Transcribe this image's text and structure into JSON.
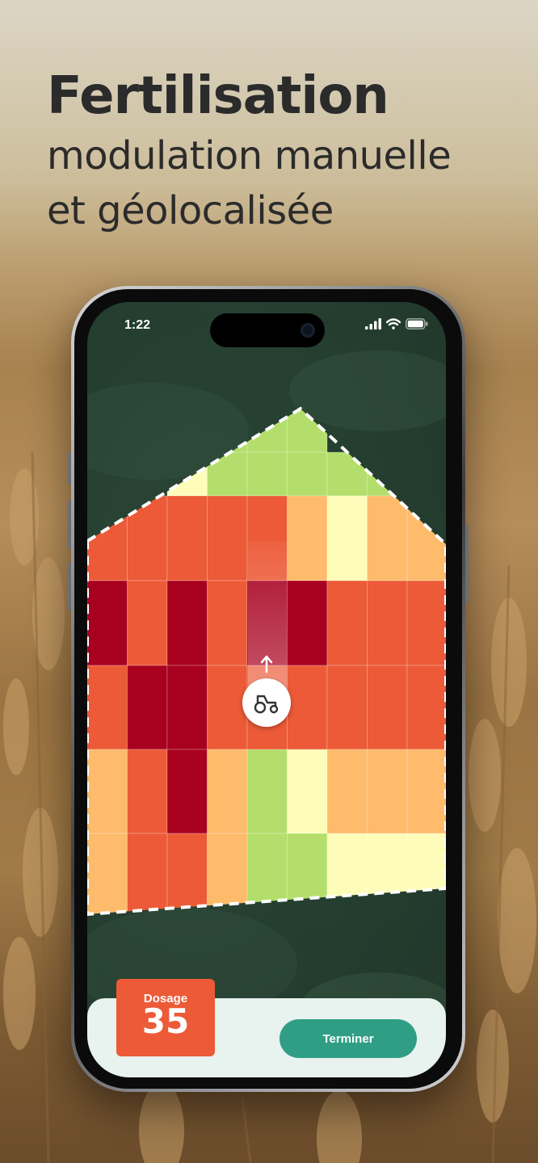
{
  "headline": {
    "title": "Fertilisation",
    "subtitle_line1": "modulation manuelle",
    "subtitle_line2": "et géolocalisée"
  },
  "status_bar": {
    "time": "1:22",
    "icons": [
      "cellular-signal-icon",
      "wifi-icon",
      "battery-icon"
    ]
  },
  "map": {
    "zone_colors": {
      "light_green": "#b3de6b",
      "pale_yellow": "#fdfdb9",
      "light_orange": "#fdbb6b",
      "orange": "#ec5a37",
      "dark_red": "#a8001f"
    },
    "grid": [
      [
        "_",
        "_",
        "_",
        "light_green",
        "light_green",
        "light_green",
        "_",
        "_",
        "_"
      ],
      [
        "_",
        "_",
        "pale_yellow",
        "light_green",
        "light_green",
        "light_green",
        "light_green",
        "light_green",
        "_"
      ],
      [
        "orange",
        "orange",
        "orange",
        "orange",
        "orange",
        "light_orange",
        "pale_yellow",
        "light_orange",
        "light_orange"
      ],
      [
        "dark_red",
        "orange",
        "dark_red",
        "orange",
        "dark_red",
        "dark_red",
        "orange",
        "orange",
        "orange"
      ],
      [
        "orange",
        "dark_red",
        "dark_red",
        "orange",
        "orange",
        "orange",
        "orange",
        "orange",
        "orange"
      ],
      [
        "light_orange",
        "orange",
        "dark_red",
        "light_orange",
        "light_green",
        "pale_yellow",
        "light_orange",
        "light_orange",
        "light_orange"
      ],
      [
        "light_orange",
        "orange",
        "orange",
        "light_orange",
        "light_green",
        "light_green",
        "pale_yellow",
        "pale_yellow",
        "pale_yellow"
      ]
    ],
    "tractor_icon": "tractor-icon",
    "direction_icon": "arrow-up-icon"
  },
  "bottom_panel": {
    "dosage_label": "Dosage",
    "dosage_value": "35",
    "finish_label": "Terminer"
  },
  "colors": {
    "accent_teal": "#2f9e84",
    "dosage_orange": "#ec5a37",
    "panel_bg": "#e8f2ef"
  }
}
